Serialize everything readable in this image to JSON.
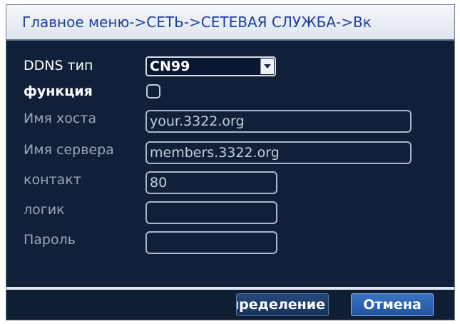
{
  "title": "Главное меню->СЕТЬ->СЕТЕВАЯ СЛУЖБА->Вк",
  "form": {
    "ddns_type": {
      "label": "DDNS тип",
      "value": "CN99"
    },
    "function": {
      "label": "функция",
      "checked": false
    },
    "hostname": {
      "label": "Имя хоста",
      "value": "your.3322.org"
    },
    "server": {
      "label": "Имя сервера",
      "value": "members.3322.org"
    },
    "port": {
      "label": "контакт",
      "value": "80"
    },
    "login": {
      "label": "логик",
      "value": ""
    },
    "password": {
      "label": "Пароль",
      "value": ""
    }
  },
  "buttons": {
    "ok_label": "определение",
    "cancel_label": "Отмена"
  },
  "colors": {
    "panel_bg": "#102038",
    "title_text": "#1d3f9e",
    "cancel_button": "#2e66b8"
  }
}
